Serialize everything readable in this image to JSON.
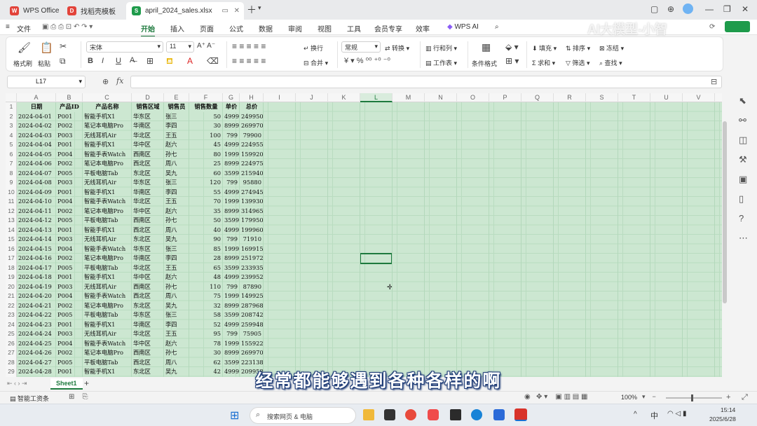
{
  "tabs": [
    {
      "label": "WPS Office",
      "icon": "wps-logo-icon"
    },
    {
      "label": "找稻壳模板",
      "icon": "docer-icon"
    },
    {
      "label": "april_2024_sales.xlsx",
      "icon": "spreadsheet-icon"
    }
  ],
  "menu": {
    "file": "文件",
    "items": [
      "开始",
      "插入",
      "页面",
      "公式",
      "数据",
      "审阅",
      "视图",
      "工具",
      "会员专享",
      "效率"
    ],
    "active": "开始",
    "wps_ai": "WPS AI"
  },
  "ribbon": {
    "format_painter": "格式刷",
    "paste": "粘贴",
    "font_name": "宋体",
    "font_size": "11",
    "wrap": "换行",
    "merge": "合并",
    "number_format": "常规",
    "convert": "转换",
    "rows_cols": "行和列",
    "worksheet": "工作表",
    "cond_format": "条件格式",
    "fill": "填充",
    "sort": "排序",
    "freeze": "冻结",
    "sum": "求和",
    "filter": "筛选",
    "find": "查找"
  },
  "formula_bar": {
    "name_box": "L17",
    "fx": "fx",
    "value": ""
  },
  "columns": [
    "A",
    "B",
    "C",
    "D",
    "E",
    "F",
    "G",
    "H",
    "I",
    "J",
    "K",
    "L",
    "M",
    "N",
    "O",
    "P",
    "Q",
    "R",
    "S",
    "T",
    "U",
    "V"
  ],
  "headers": [
    "日期",
    "产品ID",
    "产品名称",
    "销售区域",
    "销售员",
    "销售数量",
    "单价",
    "总价"
  ],
  "rows": [
    [
      "2024-04-01",
      "P001",
      "智能手机X1",
      "华东区",
      "张三",
      "50",
      "4999",
      "249950"
    ],
    [
      "2024-04-02",
      "P002",
      "笔记本电脑Pro",
      "华南区",
      "李四",
      "30",
      "8999",
      "269970"
    ],
    [
      "2024-04-03",
      "P003",
      "无线耳机Air",
      "华北区",
      "王五",
      "100",
      "799",
      "79900"
    ],
    [
      "2024-04-04",
      "P001",
      "智能手机X1",
      "华中区",
      "赵六",
      "45",
      "4999",
      "224955"
    ],
    [
      "2024-04-05",
      "P004",
      "智能手表Watch",
      "西南区",
      "孙七",
      "80",
      "1999",
      "159920"
    ],
    [
      "2024-04-06",
      "P002",
      "笔记本电脑Pro",
      "西北区",
      "周八",
      "25",
      "8999",
      "224975"
    ],
    [
      "2024-04-07",
      "P005",
      "平板电脑Tab",
      "东北区",
      "吴九",
      "60",
      "3599",
      "215940"
    ],
    [
      "2024-04-08",
      "P003",
      "无线耳机Air",
      "华东区",
      "张三",
      "120",
      "799",
      "95880"
    ],
    [
      "2024-04-09",
      "P001",
      "智能手机X1",
      "华南区",
      "李四",
      "55",
      "4999",
      "274945"
    ],
    [
      "2024-04-10",
      "P004",
      "智能手表Watch",
      "华北区",
      "王五",
      "70",
      "1999",
      "139930"
    ],
    [
      "2024-04-11",
      "P002",
      "笔记本电脑Pro",
      "华中区",
      "赵六",
      "35",
      "8999",
      "314965"
    ],
    [
      "2024-04-12",
      "P005",
      "平板电脑Tab",
      "西南区",
      "孙七",
      "50",
      "3599",
      "179950"
    ],
    [
      "2024-04-13",
      "P001",
      "智能手机X1",
      "西北区",
      "周八",
      "40",
      "4999",
      "199960"
    ],
    [
      "2024-04-14",
      "P003",
      "无线耳机Air",
      "东北区",
      "吴九",
      "90",
      "799",
      "71910"
    ],
    [
      "2024-04-15",
      "P004",
      "智能手表Watch",
      "华东区",
      "张三",
      "85",
      "1999",
      "169915"
    ],
    [
      "2024-04-16",
      "P002",
      "笔记本电脑Pro",
      "华南区",
      "李四",
      "28",
      "8999",
      "251972"
    ],
    [
      "2024-04-17",
      "P005",
      "平板电脑Tab",
      "华北区",
      "王五",
      "65",
      "3599",
      "233935"
    ],
    [
      "2024-04-18",
      "P001",
      "智能手机X1",
      "华中区",
      "赵六",
      "48",
      "4999",
      "239952"
    ],
    [
      "2024-04-19",
      "P003",
      "无线耳机Air",
      "西南区",
      "孙七",
      "110",
      "799",
      "87890"
    ],
    [
      "2024-04-20",
      "P004",
      "智能手表Watch",
      "西北区",
      "周八",
      "75",
      "1999",
      "149925"
    ],
    [
      "2024-04-21",
      "P002",
      "笔记本电脑Pro",
      "东北区",
      "吴九",
      "32",
      "8999",
      "287968"
    ],
    [
      "2024-04-22",
      "P005",
      "平板电脑Tab",
      "华东区",
      "张三",
      "58",
      "3599",
      "208742"
    ],
    [
      "2024-04-23",
      "P001",
      "智能手机X1",
      "华南区",
      "李四",
      "52",
      "4999",
      "259948"
    ],
    [
      "2024-04-24",
      "P003",
      "无线耳机Air",
      "华北区",
      "王五",
      "95",
      "799",
      "75905"
    ],
    [
      "2024-04-25",
      "P004",
      "智能手表Watch",
      "华中区",
      "赵六",
      "78",
      "1999",
      "155922"
    ],
    [
      "2024-04-26",
      "P002",
      "笔记本电脑Pro",
      "西南区",
      "孙七",
      "30",
      "8999",
      "269970"
    ],
    [
      "2024-04-27",
      "P005",
      "平板电脑Tab",
      "西北区",
      "周八",
      "62",
      "3599",
      "223138"
    ],
    [
      "2024-04-28",
      "P001",
      "智能手机X1",
      "东北区",
      "吴九",
      "42",
      "4999",
      "209958"
    ]
  ],
  "sheet_tabs": {
    "active": "Sheet1",
    "add": "+"
  },
  "status": {
    "left": "智能工资条",
    "zoom": "100%"
  },
  "taskbar": {
    "search": "搜索网页 & 电脑",
    "ime": "中",
    "time": "15:14",
    "date": "2025/6/28"
  },
  "caption": "经常都能够遇到各种各样的啊",
  "watermark": "AI大模型-小智",
  "colors": {
    "accent": "#1e7a3e",
    "selection_fill": "#cce7d1"
  }
}
